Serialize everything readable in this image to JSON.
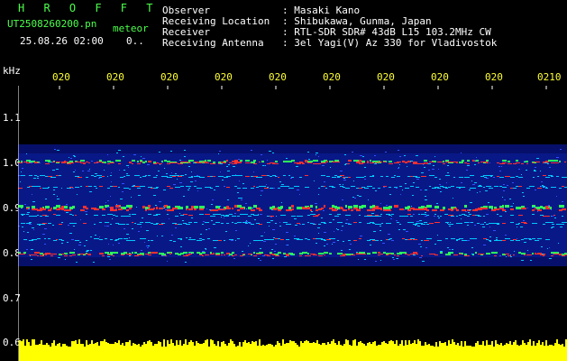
{
  "header": {
    "title": "H R O F F T",
    "filename": "UT2508260200.pn",
    "tag": "meteor",
    "timestamp": "25.08.26 02:00",
    "count": "0..",
    "fields": [
      {
        "label": "Observer",
        "value": ": Masaki Kano"
      },
      {
        "label": "Receiving Location",
        "value": ": Shibukawa, Gunma, Japan"
      },
      {
        "label": "Receiver",
        "value": ": RTL-SDR SDR# 43dB L15 103.2MHz CW"
      },
      {
        "label": "Receiving Antenna",
        "value": ": 3el Yagi(V) Az 330 for Vladivostok"
      }
    ]
  },
  "spectrogram": {
    "y_unit": "kHz",
    "y_ticks": [
      "1.1",
      "1.0",
      "0.9",
      "0.8",
      "0.7",
      "0.6"
    ],
    "x_ticks": [
      "020",
      "020",
      "020",
      "020",
      "020",
      "020",
      "020",
      "020",
      "020",
      "0210"
    ],
    "colors": {
      "background": "#000000",
      "low": "#0a1a8c",
      "mid": "#00c8ff",
      "green": "#2dff5a",
      "high": "#ff3030",
      "bar": "#ffff00"
    }
  }
}
